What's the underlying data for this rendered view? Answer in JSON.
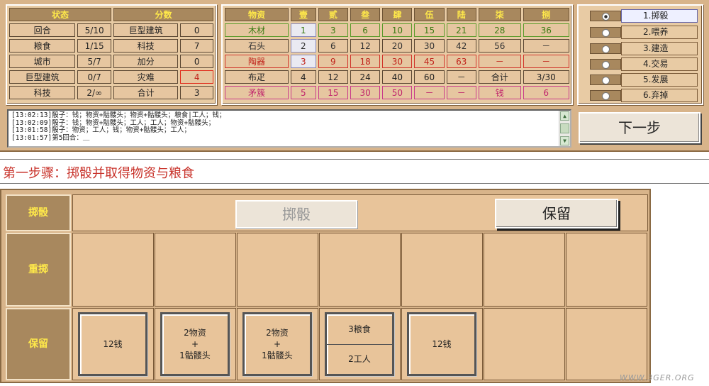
{
  "status_table": {
    "headers": [
      "状态",
      "分数"
    ],
    "rows": [
      [
        "回合",
        "5/10",
        "巨型建筑",
        "0"
      ],
      [
        "粮食",
        "1/15",
        "科技",
        "7"
      ],
      [
        "城市",
        "5/7",
        "加分",
        "0"
      ],
      [
        "巨型建筑",
        "0/7",
        "灾难",
        "4"
      ],
      [
        "科技",
        "2/∞",
        "合计",
        "3"
      ]
    ]
  },
  "goods_table": {
    "headers": [
      "物资",
      "壹",
      "贰",
      "叁",
      "肆",
      "伍",
      "陆",
      "柒",
      "捌"
    ],
    "rows": [
      [
        "木材",
        "1",
        "3",
        "6",
        "10",
        "15",
        "21",
        "28",
        "36"
      ],
      [
        "石头",
        "2",
        "6",
        "12",
        "20",
        "30",
        "42",
        "56",
        "－"
      ],
      [
        "陶器",
        "3",
        "9",
        "18",
        "30",
        "45",
        "63",
        "－",
        "－"
      ],
      [
        "布疋",
        "4",
        "12",
        "24",
        "40",
        "60",
        "－",
        "合计",
        "3/30"
      ],
      [
        "矛簇",
        "5",
        "15",
        "30",
        "50",
        "－",
        "－",
        "钱",
        "6"
      ]
    ]
  },
  "options": [
    {
      "label": "1.掷骰",
      "selected": true
    },
    {
      "label": "2.喂养",
      "selected": false
    },
    {
      "label": "3.建造",
      "selected": false
    },
    {
      "label": "4.交易",
      "selected": false
    },
    {
      "label": "5.发展",
      "selected": false
    },
    {
      "label": "6.弃掉",
      "selected": false
    }
  ],
  "log_lines": [
    "[13:02:13]骰子：钱；物资+骷髅头；物资+骷髅头；粮食|工人；钱；",
    "[13:02:09]骰子：钱；物资+骷髅头；工人；工人；物资+骷髅头；",
    "[13:01:58]骰子：物资；工人；钱；物资+骷髅头；工人；",
    "[13:01:57]第5回合：＿"
  ],
  "next_button": "下一步",
  "step_title": "第一步骤：掷骰并取得物资与粮食",
  "board": {
    "row_labels": [
      "掷骰",
      "重掷",
      "保留"
    ],
    "roll_button": "掷骰",
    "keep_button": "保留",
    "kept_dice": [
      {
        "lines": [
          "12钱"
        ]
      },
      {
        "lines": [
          "2物资",
          "+",
          "1骷髅头"
        ]
      },
      {
        "lines": [
          "2物资",
          "+",
          "1骷髅头"
        ]
      },
      {
        "top": "3粮食",
        "bottom": "2工人"
      },
      {
        "lines": [
          "12钱"
        ]
      }
    ]
  },
  "watermark": "WWW.3GER.ORG"
}
